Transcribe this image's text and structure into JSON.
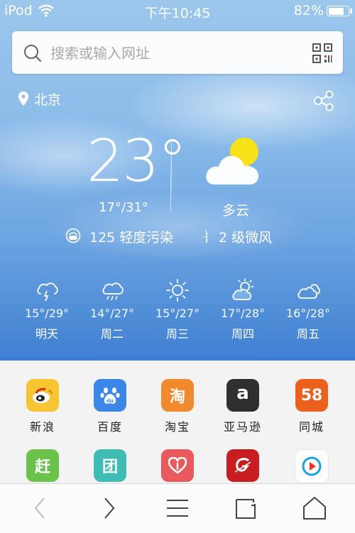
{
  "status": {
    "carrier": "iPod",
    "time": "下午10:45",
    "battery": "82%",
    "battery_level": 0.82
  },
  "search": {
    "placeholder": "搜索或输入网址"
  },
  "weather": {
    "city": "北京",
    "temperature": "23°",
    "range": "17°/31°",
    "condition": "多云",
    "aqi": "125  轻度污染",
    "wind": "2 级微风"
  },
  "forecast": [
    {
      "range": "15°/29°",
      "day": "明天",
      "icon": "thunderstorm-icon"
    },
    {
      "range": "14°/27°",
      "day": "周二",
      "icon": "rain-icon"
    },
    {
      "range": "15°/27°",
      "day": "周三",
      "icon": "sunny-icon"
    },
    {
      "range": "17°/28°",
      "day": "周四",
      "icon": "partly-cloudy-icon"
    },
    {
      "range": "16°/28°",
      "day": "周五",
      "icon": "cloudy-icon"
    }
  ],
  "shortcuts": [
    {
      "label": "新浪",
      "icon": "sina-weibo-icon",
      "glyph": "",
      "color": "#f7c531"
    },
    {
      "label": "百度",
      "icon": "baidu-icon",
      "glyph": "",
      "color": "#3b86e6"
    },
    {
      "label": "淘宝",
      "icon": "taobao-icon",
      "glyph": "淘",
      "color": "#f08a2c"
    },
    {
      "label": "亚马逊",
      "icon": "amazon-icon",
      "glyph": "a",
      "color": "#2f2f2f"
    },
    {
      "label": "同城",
      "icon": "58-tongcheng-icon",
      "glyph": "58",
      "color": "#ec5f1c"
    },
    {
      "label": "",
      "icon": "ganji-icon",
      "glyph": "赶",
      "color": "#6ac24a"
    },
    {
      "label": "",
      "icon": "tuan-icon",
      "glyph": "团",
      "color": "#3fbdb5"
    },
    {
      "label": "",
      "icon": "heart-app-icon",
      "glyph": "",
      "color": "#e85a5e"
    },
    {
      "label": "",
      "icon": "red-g-app-icon",
      "glyph": "",
      "color": "#c81e22"
    },
    {
      "label": "",
      "icon": "video-play-icon",
      "glyph": "",
      "color": "#ffffff"
    }
  ],
  "toolbar": [
    "back-icon",
    "forward-icon",
    "menu-icon",
    "tabs-icon",
    "home-icon"
  ]
}
